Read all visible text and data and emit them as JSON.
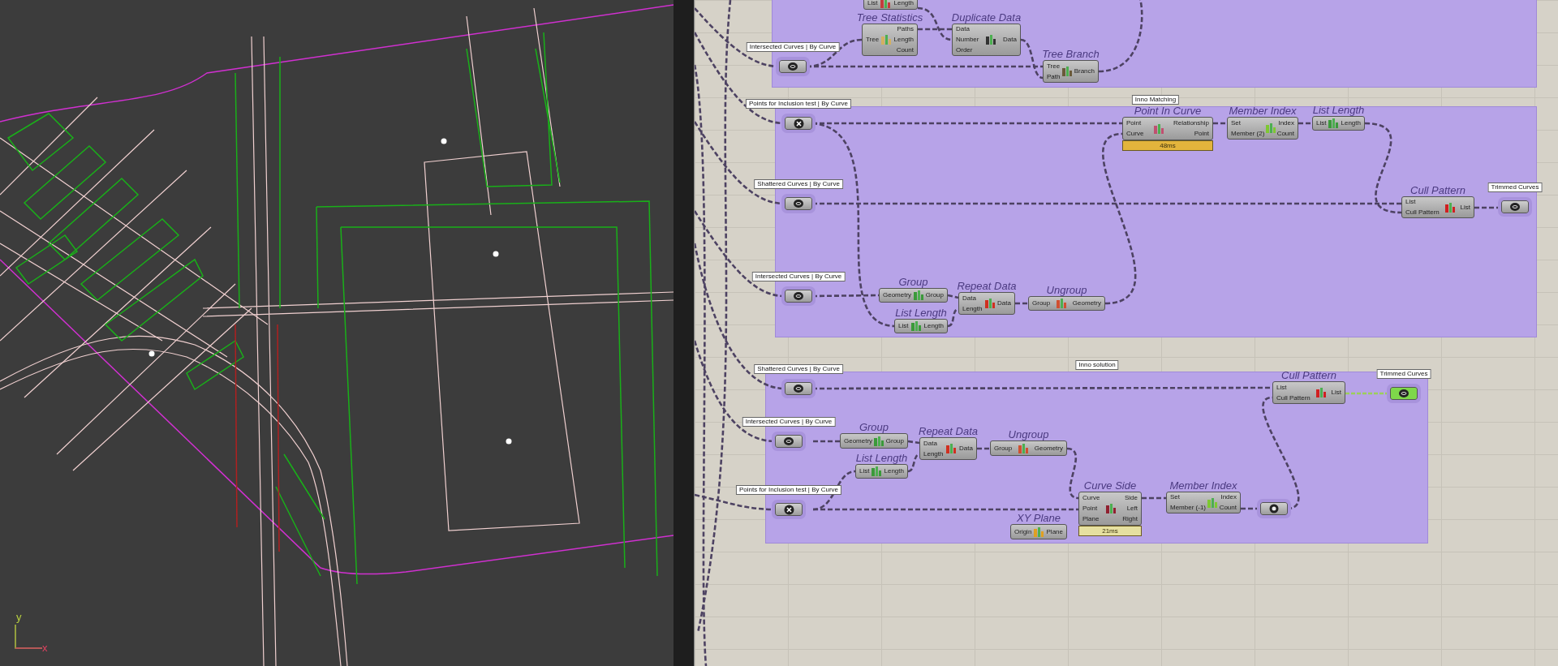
{
  "viewport": {
    "axis_labels": [
      "y",
      "x"
    ]
  },
  "canvas": {
    "group_labels": [
      "Inno Matching",
      "Inno solution"
    ],
    "params": [
      {
        "label": "Intersected Curves | By Curve",
        "kind": "curve",
        "selected": false
      },
      {
        "label": "Points for Inclusion test | By Curve",
        "kind": "point",
        "selected": false
      },
      {
        "label": "Shattered Curves | By Curve",
        "kind": "curve",
        "selected": false
      },
      {
        "label": "Intersected Curves | By Curve",
        "kind": "curve",
        "selected": false
      },
      {
        "label": "Trimmed Curves",
        "kind": "curve",
        "selected": false
      },
      {
        "label": "Shattered Curves | By Curve",
        "kind": "curve",
        "selected": false
      },
      {
        "label": "Intersected Curves | By Curve",
        "kind": "curve",
        "selected": false
      },
      {
        "label": "Points for Inclusion test | By Curve",
        "kind": "point",
        "selected": false
      },
      {
        "kind": "dial",
        "selected": false
      },
      {
        "label": "Trimmed Curves",
        "kind": "curve",
        "selected": true
      }
    ],
    "nodes": [
      {
        "inputs": [
          "List"
        ],
        "outputs": [
          "Length"
        ]
      },
      {
        "title": "Tree Statistics",
        "inputs": [
          "Tree"
        ],
        "outputs": [
          "Paths",
          "Length",
          "Count"
        ]
      },
      {
        "title": "Duplicate Data",
        "inputs": [
          "Data",
          "Number",
          "Order"
        ],
        "outputs": [
          "Data"
        ]
      },
      {
        "title": "Tree Branch",
        "inputs": [
          "Tree",
          "Path"
        ],
        "outputs": [
          "Branch"
        ]
      },
      {
        "title": "Point In Curve",
        "inputs": [
          "Point",
          "Curve"
        ],
        "outputs": [
          "Relationship",
          "Point"
        ],
        "timing": "48ms"
      },
      {
        "title": "Member Index",
        "inputs": [
          "Set",
          "Member (2)"
        ],
        "outputs": [
          "Index",
          "Count"
        ]
      },
      {
        "title": "List Length",
        "inputs": [
          "List"
        ],
        "outputs": [
          "Length"
        ]
      },
      {
        "title": "Cull Pattern",
        "inputs": [
          "List",
          "Cull Pattern"
        ],
        "outputs": [
          "List"
        ]
      },
      {
        "title": "Group",
        "inputs": [
          "Geometry"
        ],
        "outputs": [
          "Group"
        ]
      },
      {
        "title": "Repeat Data",
        "inputs": [
          "Data",
          "Length"
        ],
        "outputs": [
          "Data"
        ]
      },
      {
        "title": "Ungroup",
        "inputs": [
          "Group"
        ],
        "outputs": [
          "Geometry"
        ]
      },
      {
        "title": "List Length",
        "inputs": [
          "List"
        ],
        "outputs": [
          "Length"
        ]
      },
      {
        "title": "Cull Pattern",
        "inputs": [
          "List",
          "Cull Pattern"
        ],
        "outputs": [
          "List"
        ]
      },
      {
        "title": "Group",
        "inputs": [
          "Geometry"
        ],
        "outputs": [
          "Group"
        ]
      },
      {
        "title": "Repeat Data",
        "inputs": [
          "Data",
          "Length"
        ],
        "outputs": [
          "Data"
        ]
      },
      {
        "title": "Ungroup",
        "inputs": [
          "Group"
        ],
        "outputs": [
          "Geometry"
        ]
      },
      {
        "title": "List Length",
        "inputs": [
          "List"
        ],
        "outputs": [
          "Length"
        ]
      },
      {
        "title": "XY Plane",
        "inputs": [
          "Origin"
        ],
        "outputs": [
          "Plane"
        ]
      },
      {
        "title": "Curve Side",
        "inputs": [
          "Curve",
          "Point",
          "Plane"
        ],
        "outputs": [
          "Side",
          "Left",
          "Right"
        ],
        "timing": "21ms"
      },
      {
        "title": "Member Index",
        "inputs": [
          "Set",
          "Member (-1)"
        ],
        "outputs": [
          "Index",
          "Count"
        ]
      }
    ]
  }
}
